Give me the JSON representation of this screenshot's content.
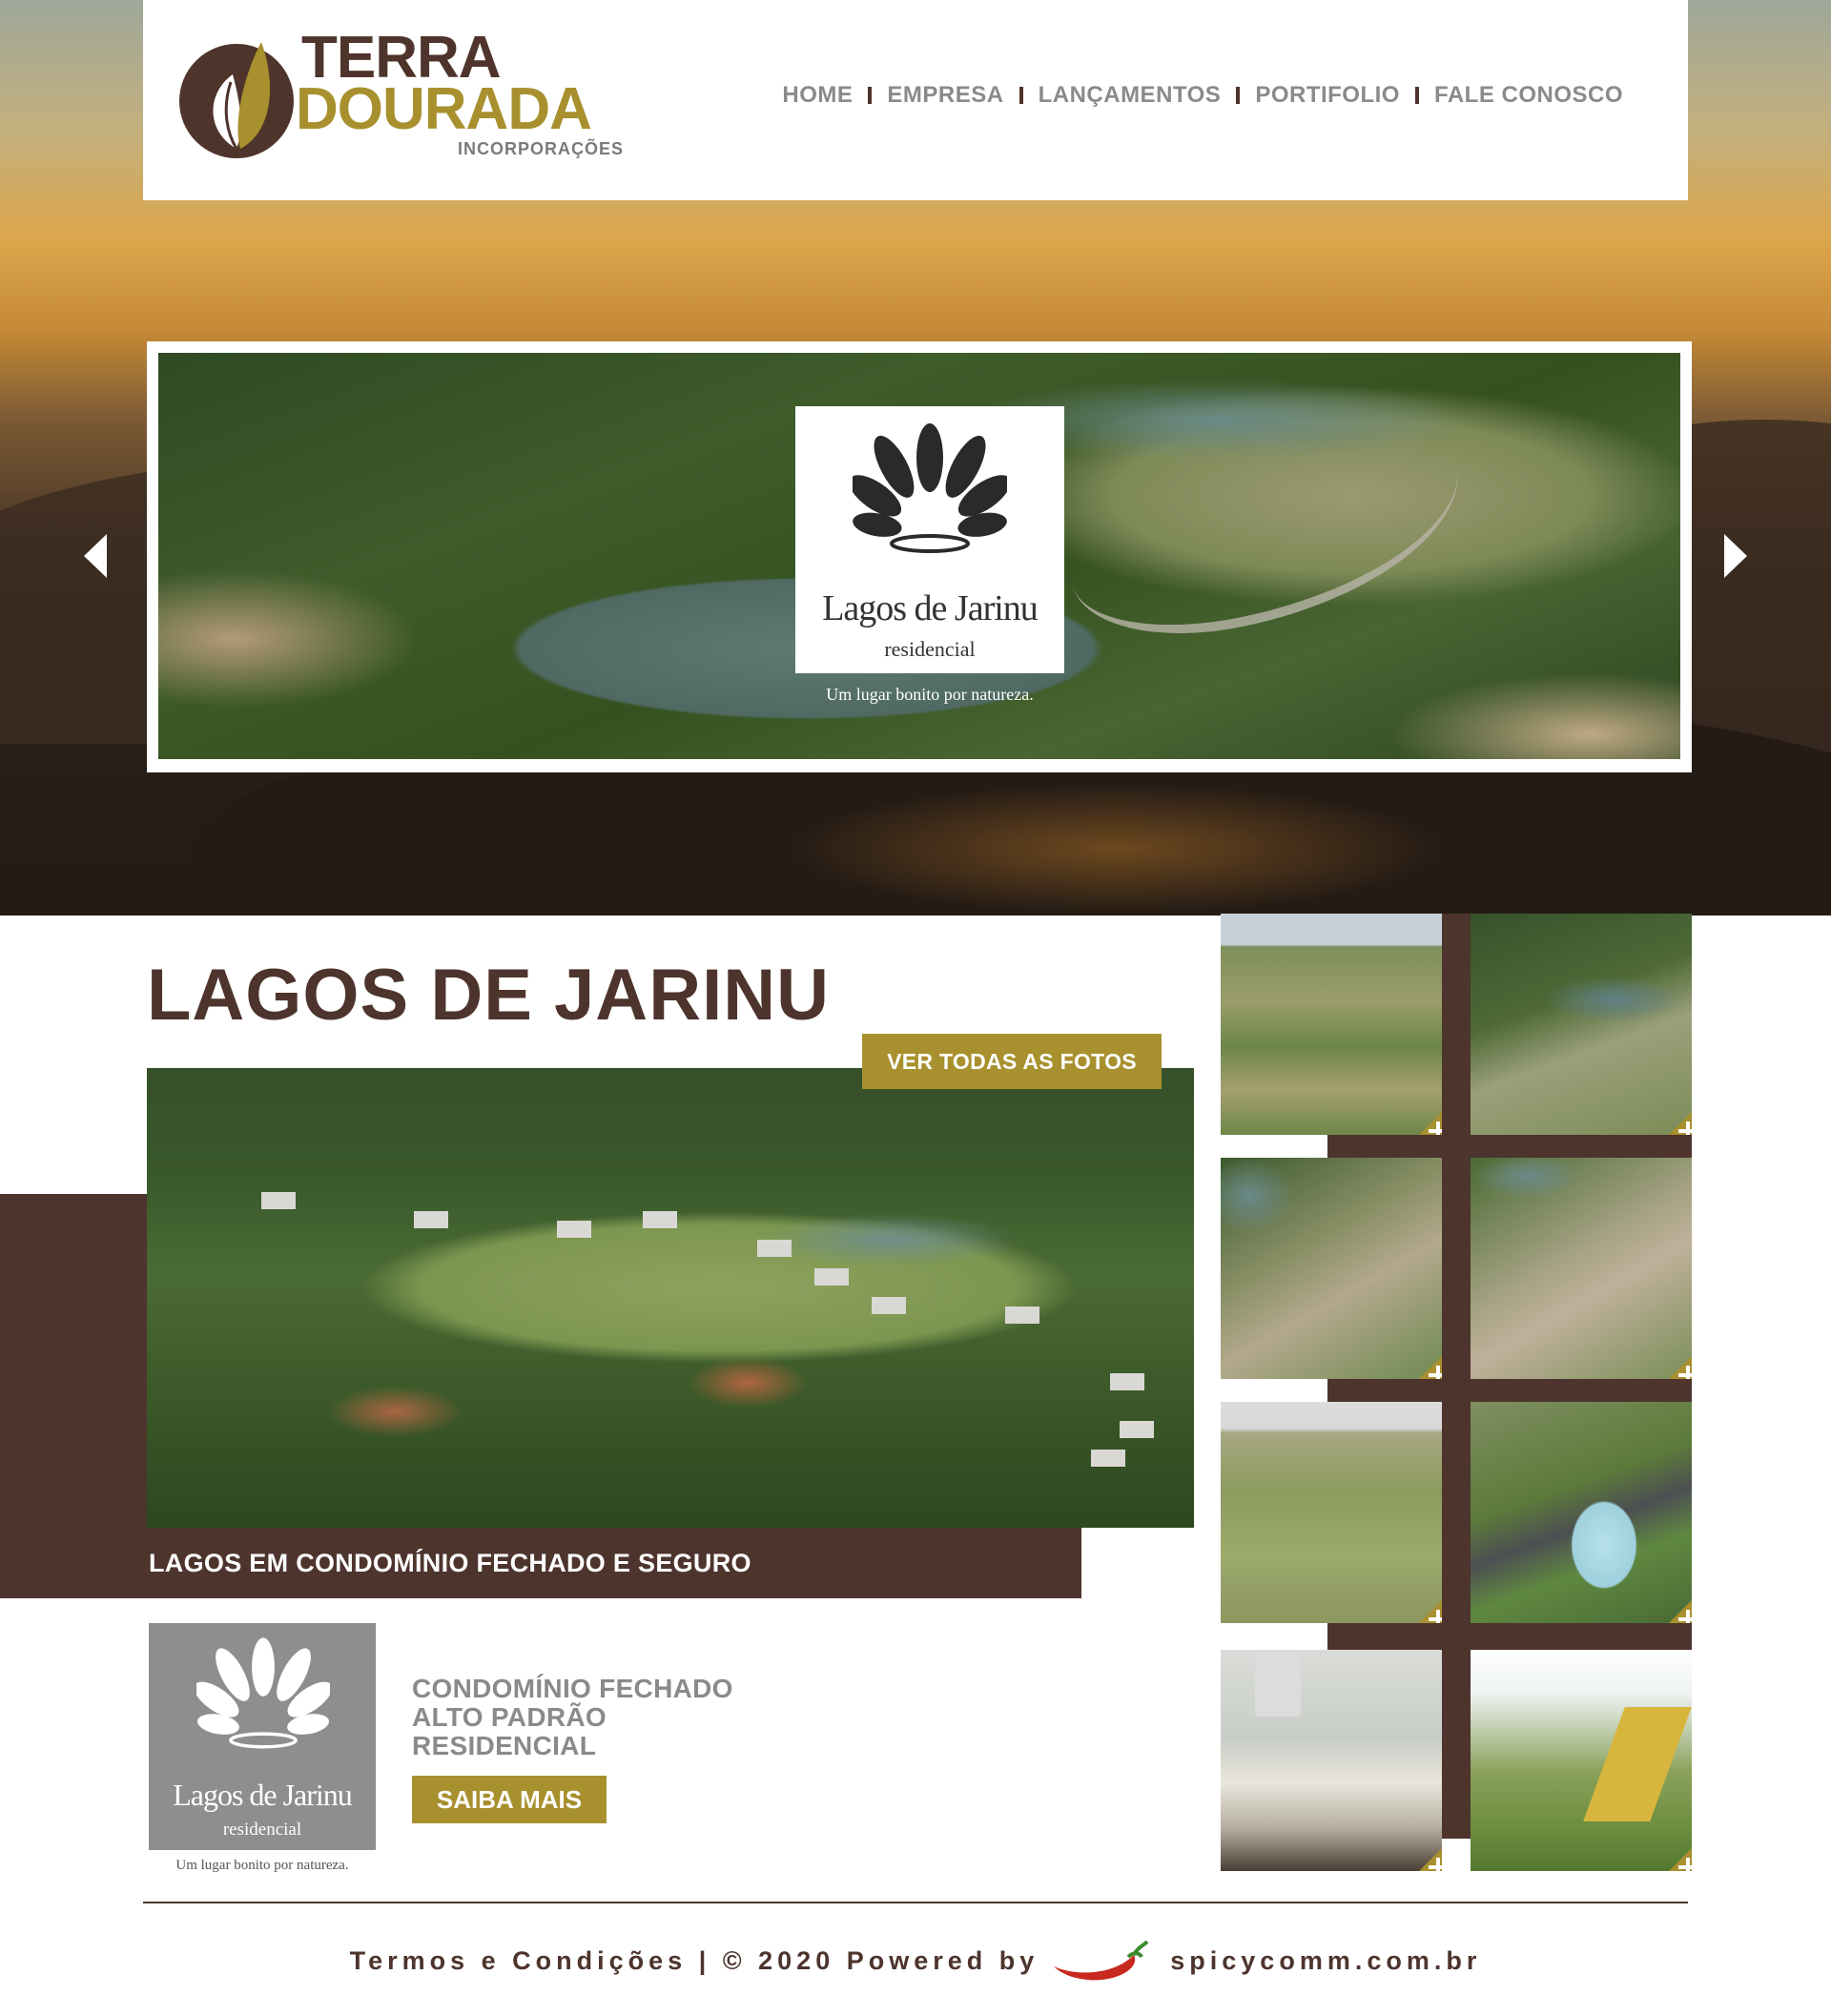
{
  "header": {
    "logo": {
      "line1": "TERRA",
      "line2": "DOURADA",
      "line3": "INCORPORAÇÕES"
    },
    "nav": [
      {
        "label": "HOME"
      },
      {
        "label": "EMPRESA"
      },
      {
        "label": "LANÇAMENTOS"
      },
      {
        "label": "PORTIFOLIO"
      },
      {
        "label": "FALE CONOSCO"
      }
    ]
  },
  "slider": {
    "badge_name": "Lagos de Jarinu",
    "badge_sub": "residencial",
    "tagline": "Um lugar bonito por natureza.",
    "prev_icon": "arrow-left-icon",
    "next_icon": "arrow-right-icon"
  },
  "project": {
    "title": "LAGOS DE JARINU",
    "see_all_button": "VER TODAS AS FOTOS",
    "photo_caption": "LAGOS EM CONDOMÍNIO FECHADO E SEGURO",
    "logo_name": "Lagos de Jarinu",
    "logo_sub": "residencial",
    "logo_tagline": "Um lugar bonito por natureza.",
    "desc_line1": "CONDOMÍNIO FECHADO",
    "desc_line2": "ALTO PADRÃO",
    "desc_line3": "RESIDENCIAL",
    "more_button": "SAIBA MAIS"
  },
  "gallery": {
    "thumb_count": 8,
    "expand_icon": "plus-icon"
  },
  "footer": {
    "text_left": "Termos e Condições | © 2020 Powered by",
    "text_right": "spicycomm.com.br",
    "logo_icon": "chili-pepper-icon"
  },
  "colors": {
    "brown": "#4d342d",
    "gold": "#a8902e",
    "gray_text": "#8a8a8a"
  }
}
